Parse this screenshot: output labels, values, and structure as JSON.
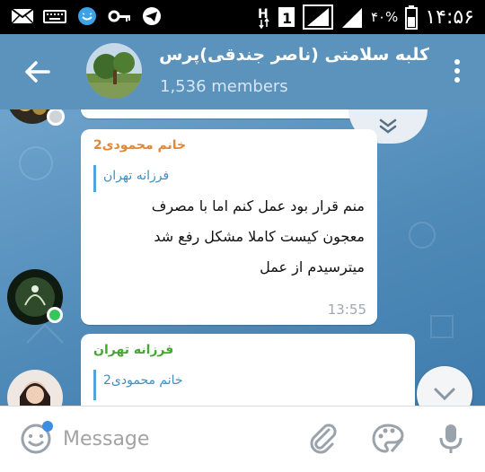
{
  "status_bar": {
    "time": "۱۴:۵۶",
    "battery": "۴۰%",
    "icons": [
      "mail-icon",
      "keyboard-icon",
      "smiley-app-icon",
      "key-icon",
      "telegram-icon",
      "hd-icon",
      "sim1-icon",
      "signal-icon",
      "signal-icon",
      "battery-icon"
    ]
  },
  "header": {
    "title": "کلبه سلامتی (ناصر جندقی)پرس...",
    "subtitle": "1,536 members",
    "back_icon": "arrow-left-icon",
    "menu_icon": "more-vert-icon"
  },
  "messages": [
    {
      "sender": "خانم محمودی2",
      "sender_color": "#e0883a",
      "reply_to": "فرزانه تهران",
      "lines": [
        "منم قرار بود عمل کنم اما با مصرف",
        "معجون کیست کاملا مشکل رفع شد",
        "میترسیدم از عمل"
      ],
      "time": "13:55"
    },
    {
      "sender": "فرزانه تهران",
      "sender_color": "#46a633",
      "reply_to": "خانم محمودی2"
    }
  ],
  "input": {
    "placeholder": "Message",
    "icons": [
      "emoji-icon",
      "attach-icon",
      "palette-icon",
      "mic-icon"
    ]
  },
  "colors": {
    "header": "#5b93bd",
    "accent": "#56a3d9",
    "online": "#35c759"
  }
}
